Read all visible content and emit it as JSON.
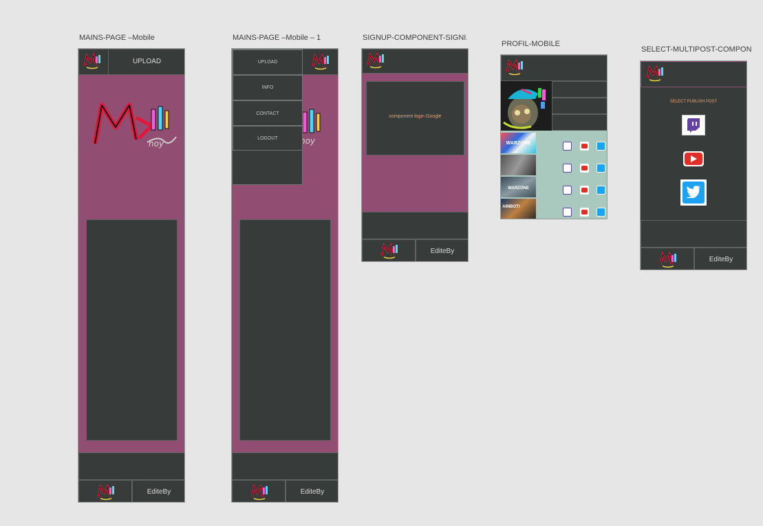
{
  "artboards": {
    "main": {
      "title": "MAINS-PAGE –Mobile",
      "upload": "UPLOAD",
      "footer_text": "EditeBy"
    },
    "main_menu": {
      "title": "MAINS-PAGE –Mobile – 1",
      "menu": [
        "UPLOAD",
        "INFO",
        "CONTACT",
        "LOGOUT"
      ],
      "footer_text": "EditeBy"
    },
    "signup": {
      "title": "SIGNUP-COMPONENT-SIGNI...",
      "component_label": "component login Google",
      "footer_text": "EditeBy"
    },
    "profil": {
      "title": "PROFIL-MOBILE",
      "thumbnail_labels": [
        "WARZONE",
        "WARZONE",
        "AIMBOT!"
      ]
    },
    "multipost": {
      "title": "SELECT-MULTIPOST-COMPON...",
      "heading": "SELECT PUBLISH POST",
      "footer_text": "EditeBy"
    }
  },
  "colors": {
    "canvas": "#e6e6e6",
    "frame": "#373b3a",
    "pink": "#924d72",
    "accent": "#e7a070",
    "twitch": "#6441a5",
    "youtube": "#e52d27",
    "twitter": "#1da1f2"
  },
  "icons": [
    "logo-icon",
    "twitch-icon",
    "youtube-icon",
    "twitter-icon"
  ]
}
